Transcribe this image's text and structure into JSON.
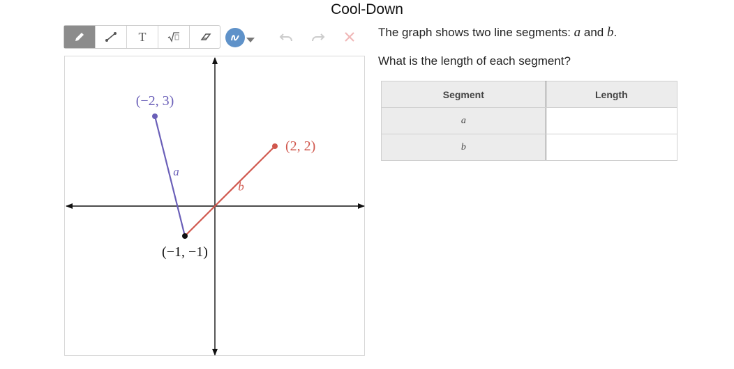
{
  "title": "Cool-Down",
  "toolbar": {
    "tools": [
      "pencil-icon",
      "segment-icon",
      "text-icon",
      "sqrt-icon",
      "eraser-icon"
    ],
    "color_accent": "#5f92c9",
    "text_tool_label": "T"
  },
  "prompt": {
    "line1_before": "The graph shows two line segments:",
    "var_a": "a",
    "and": "and",
    "var_b": "b",
    "period": ".",
    "question": "What is the length of each segment?"
  },
  "graph": {
    "segment_a_color": "#6a5fb8",
    "segment_b_color": "#d0574d",
    "shared_point_color": "#111111",
    "points": {
      "p1": {
        "x": -2,
        "y": 3,
        "label": "(−2, 3)"
      },
      "p2": {
        "x": 2,
        "y": 2,
        "label": "(2, 2)"
      },
      "p3": {
        "x": -1,
        "y": -1,
        "label": "(−1, −1)"
      }
    },
    "segment_a_label": "a",
    "segment_b_label": "b"
  },
  "table": {
    "headers": [
      "Segment",
      "Length"
    ],
    "rows": [
      {
        "segment": "a",
        "length": ""
      },
      {
        "segment": "b",
        "length": ""
      }
    ]
  }
}
